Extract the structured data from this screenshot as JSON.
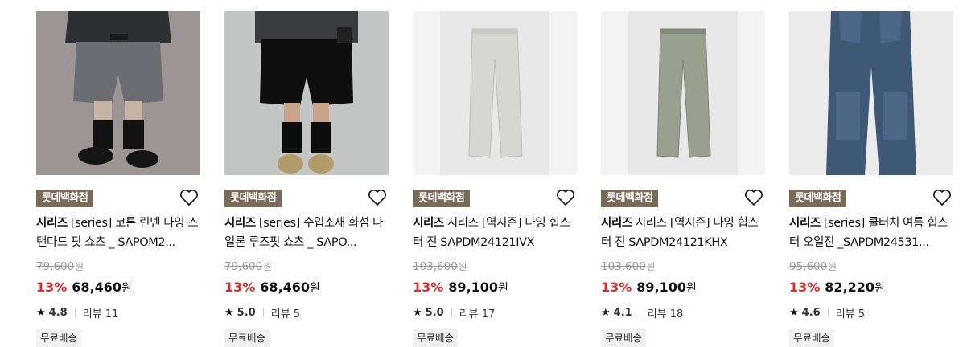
{
  "products": [
    {
      "store": "롯데백화점",
      "brand": "시리즈",
      "title": "[series] 코튼 린넨 다잉 스탠다드 핏 쇼츠 _ SAPOM2...",
      "orig_price": "79,600",
      "unit": "원",
      "discount": "13%",
      "sale_price": "68,460",
      "rating": "4.8",
      "review_label": "리뷰 11",
      "shipping": "무료배송",
      "image": "shorts-grey-model"
    },
    {
      "store": "롯데백화점",
      "brand": "시리즈",
      "title": "[series] 수입소재 화섬 나일론 루즈핏 쇼츠 _ SAPO...",
      "orig_price": "79,600",
      "unit": "원",
      "discount": "13%",
      "sale_price": "68,460",
      "rating": "5.0",
      "review_label": "리뷰 5",
      "shipping": "무료배송",
      "image": "shorts-black-model"
    },
    {
      "store": "롯데백화점",
      "brand": "시리즈",
      "title": "시리즈 [역시즌] 다잉 힙스터 진 SAPDM24121IVX",
      "orig_price": "103,600",
      "unit": "원",
      "discount": "13%",
      "sale_price": "89,100",
      "rating": "5.0",
      "review_label": "리뷰 17",
      "shipping": "무료배송",
      "image": "pants-ivory"
    },
    {
      "store": "롯데백화점",
      "brand": "시리즈",
      "title": "시리즈 [역시즌] 다잉 힙스터 진 SAPDM24121KHX",
      "orig_price": "103,600",
      "unit": "원",
      "discount": "13%",
      "sale_price": "89,100",
      "rating": "4.1",
      "review_label": "리뷰 18",
      "shipping": "무료배송",
      "image": "pants-khaki"
    },
    {
      "store": "롯데백화점",
      "brand": "시리즈",
      "title": "[series] 쿨터치 여름 힙스터 오일진 _SAPDM24531...",
      "orig_price": "95,600",
      "unit": "원",
      "discount": "13%",
      "sale_price": "82,220",
      "rating": "4.6",
      "review_label": "리뷰 5",
      "shipping": "무료배송",
      "image": "jeans-blue"
    }
  ],
  "colors": {
    "badge": "#7a6a58",
    "discount": "#e32828"
  },
  "icons": {
    "wishlist": "heart-outline-icon",
    "rating": "star-icon"
  }
}
